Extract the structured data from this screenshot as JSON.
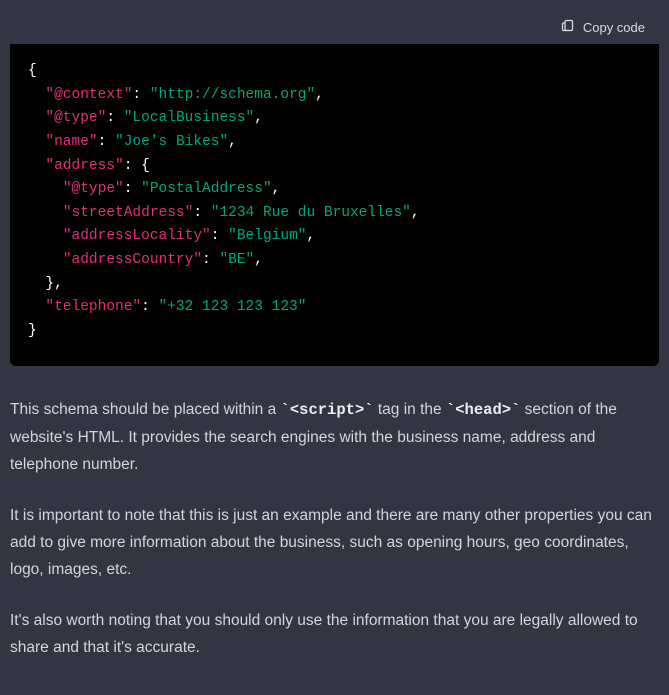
{
  "header": {
    "copy_label": "Copy code"
  },
  "code": {
    "l1": "{",
    "l2_k": "\"@context\"",
    "l2_s": "\"http://schema.org\"",
    "l3_k": "\"@type\"",
    "l3_s": "\"LocalBusiness\"",
    "l4_k": "\"name\"",
    "l4_s": "\"Joe's Bikes\"",
    "l5_k": "\"address\"",
    "l5_rest": ": {",
    "l6_k": "\"@type\"",
    "l6_s": "\"PostalAddress\"",
    "l7_k": "\"streetAddress\"",
    "l7_s": "\"1234 Rue du Bruxelles\"",
    "l8_k": "\"addressLocality\"",
    "l8_s": "\"Belgium\"",
    "l9_k": "\"addressCountry\"",
    "l9_s": "\"BE\"",
    "l10": "  },",
    "l11_k": "\"telephone\"",
    "l11_s": "\"+32 123 123 123\"",
    "l12": "}",
    "colon": ": ",
    "comma": ",",
    "ind1": "  ",
    "ind2": "    "
  },
  "paragraphs": {
    "p1_a": "This schema should be placed within a ",
    "p1_code1": "`<script>`",
    "p1_b": " tag in the ",
    "p1_code2": "`<head>`",
    "p1_c": " section of the website's HTML. It provides the search engines with the business name, address and telephone number.",
    "p2": "It is important to note that this is just an example and there are many other properties you can add to give more information about the business, such as opening hours, geo coordinates, logo, images, etc.",
    "p3": "It's also worth noting that you should only use the information that you are legally allowed to share and that it's accurate."
  },
  "chart_data": {
    "type": "table",
    "title": "LocalBusiness JSON-LD schema",
    "data": {
      "@context": "http://schema.org",
      "@type": "LocalBusiness",
      "name": "Joe's Bikes",
      "address": {
        "@type": "PostalAddress",
        "streetAddress": "1234 Rue du Bruxelles",
        "addressLocality": "Belgium",
        "addressCountry": "BE"
      },
      "telephone": "+32 123 123 123"
    }
  }
}
